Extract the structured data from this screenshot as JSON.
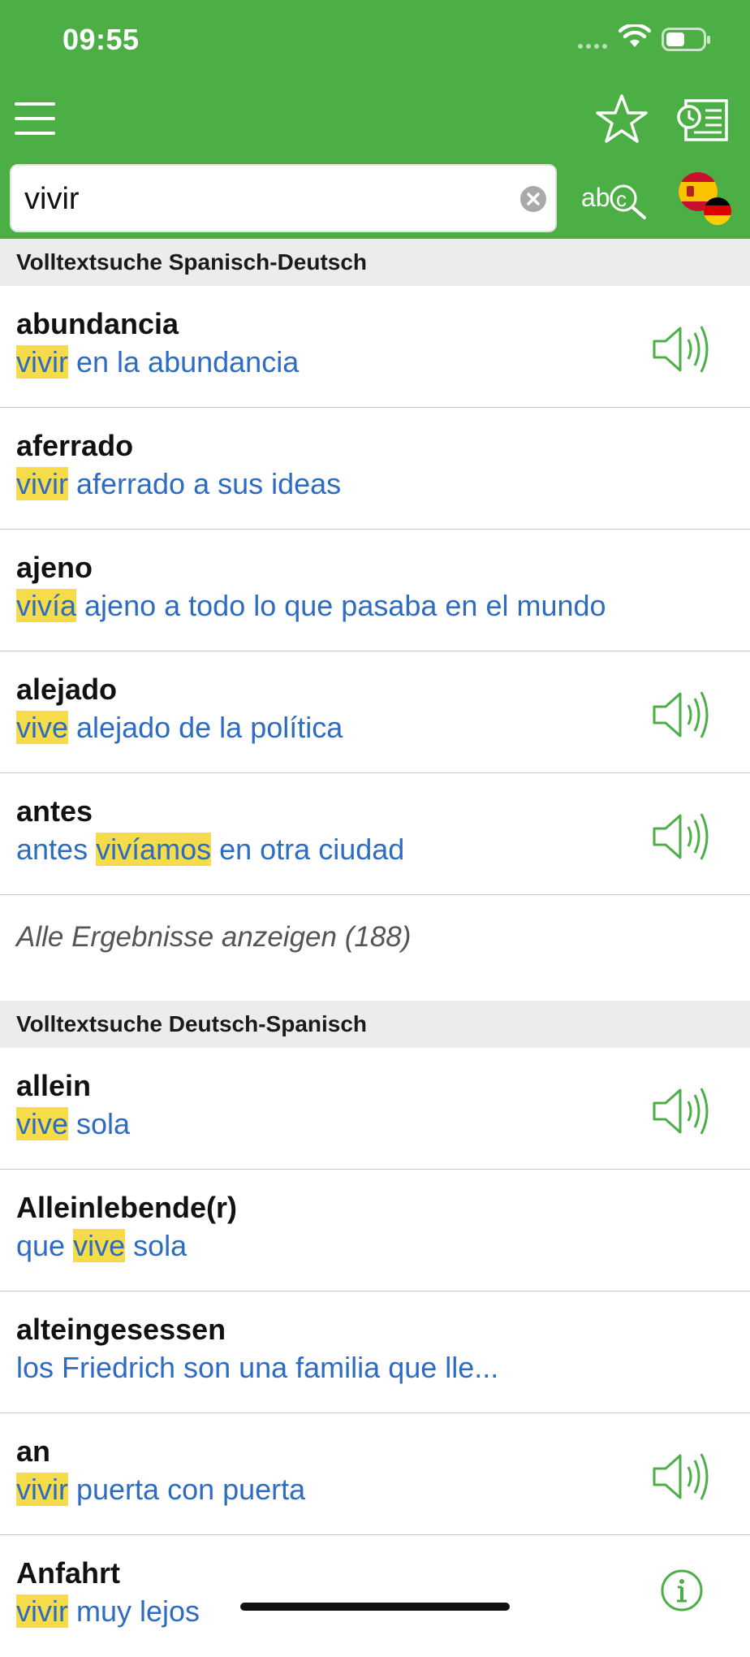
{
  "status": {
    "time": "09:55"
  },
  "search": {
    "value": "vivir"
  },
  "colors": {
    "brand": "#4caf45",
    "link": "#2d6cc0",
    "highlight": "#f6dc4a",
    "speaker": "#4caf45"
  },
  "icons": {
    "menu": "hamburger-icon",
    "favorites": "star-icon",
    "history": "history-list-icon",
    "clear": "clear-circle-icon",
    "spellcheck": "abc-search-icon",
    "language": "spain-germany-flag-icon",
    "audio": "speaker-icon",
    "info": "info-icon"
  },
  "sections": [
    {
      "title": "Volltextsuche Spanisch-Deutsch",
      "entries": [
        {
          "headword": "abundancia",
          "example_before": "",
          "example_highlight": "vivir",
          "example_after": " en la abundancia",
          "audio": true
        },
        {
          "headword": "aferrado",
          "example_before": "",
          "example_highlight": "vivir",
          "example_after": " aferrado a sus ideas",
          "audio": false
        },
        {
          "headword": "ajeno",
          "example_before": "",
          "example_highlight": "vivía",
          "example_after": " ajeno a todo lo que pasaba en el mundo",
          "audio": false
        },
        {
          "headword": "alejado",
          "example_before": "",
          "example_highlight": "vive",
          "example_after": " alejado de la política",
          "audio": true
        },
        {
          "headword": "antes",
          "example_before": "antes ",
          "example_highlight": "vivíamos",
          "example_after": " en otra ciudad",
          "audio": true
        }
      ],
      "show_all_label": "Alle Ergebnisse anzeigen (188)"
    },
    {
      "title": "Volltextsuche Deutsch-Spanisch",
      "entries": [
        {
          "headword": "allein",
          "example_before": "",
          "example_highlight": "vive",
          "example_after": " sola",
          "audio": true
        },
        {
          "headword": "Alleinlebende(r)",
          "example_before": "que ",
          "example_highlight": "vive",
          "example_after": " sola",
          "audio": false
        },
        {
          "headword": "alteingesessen",
          "example_before": "los Friedrich son una familia que lle...",
          "example_highlight": "",
          "example_after": "",
          "audio": false
        },
        {
          "headword": "an",
          "example_before": "",
          "example_highlight": "vivir",
          "example_after": " puerta con puerta",
          "audio": true
        },
        {
          "headword": "Anfahrt",
          "example_before": "",
          "example_highlight": "vivir",
          "example_after": " muy lejos",
          "audio": false,
          "info": true
        }
      ]
    }
  ]
}
